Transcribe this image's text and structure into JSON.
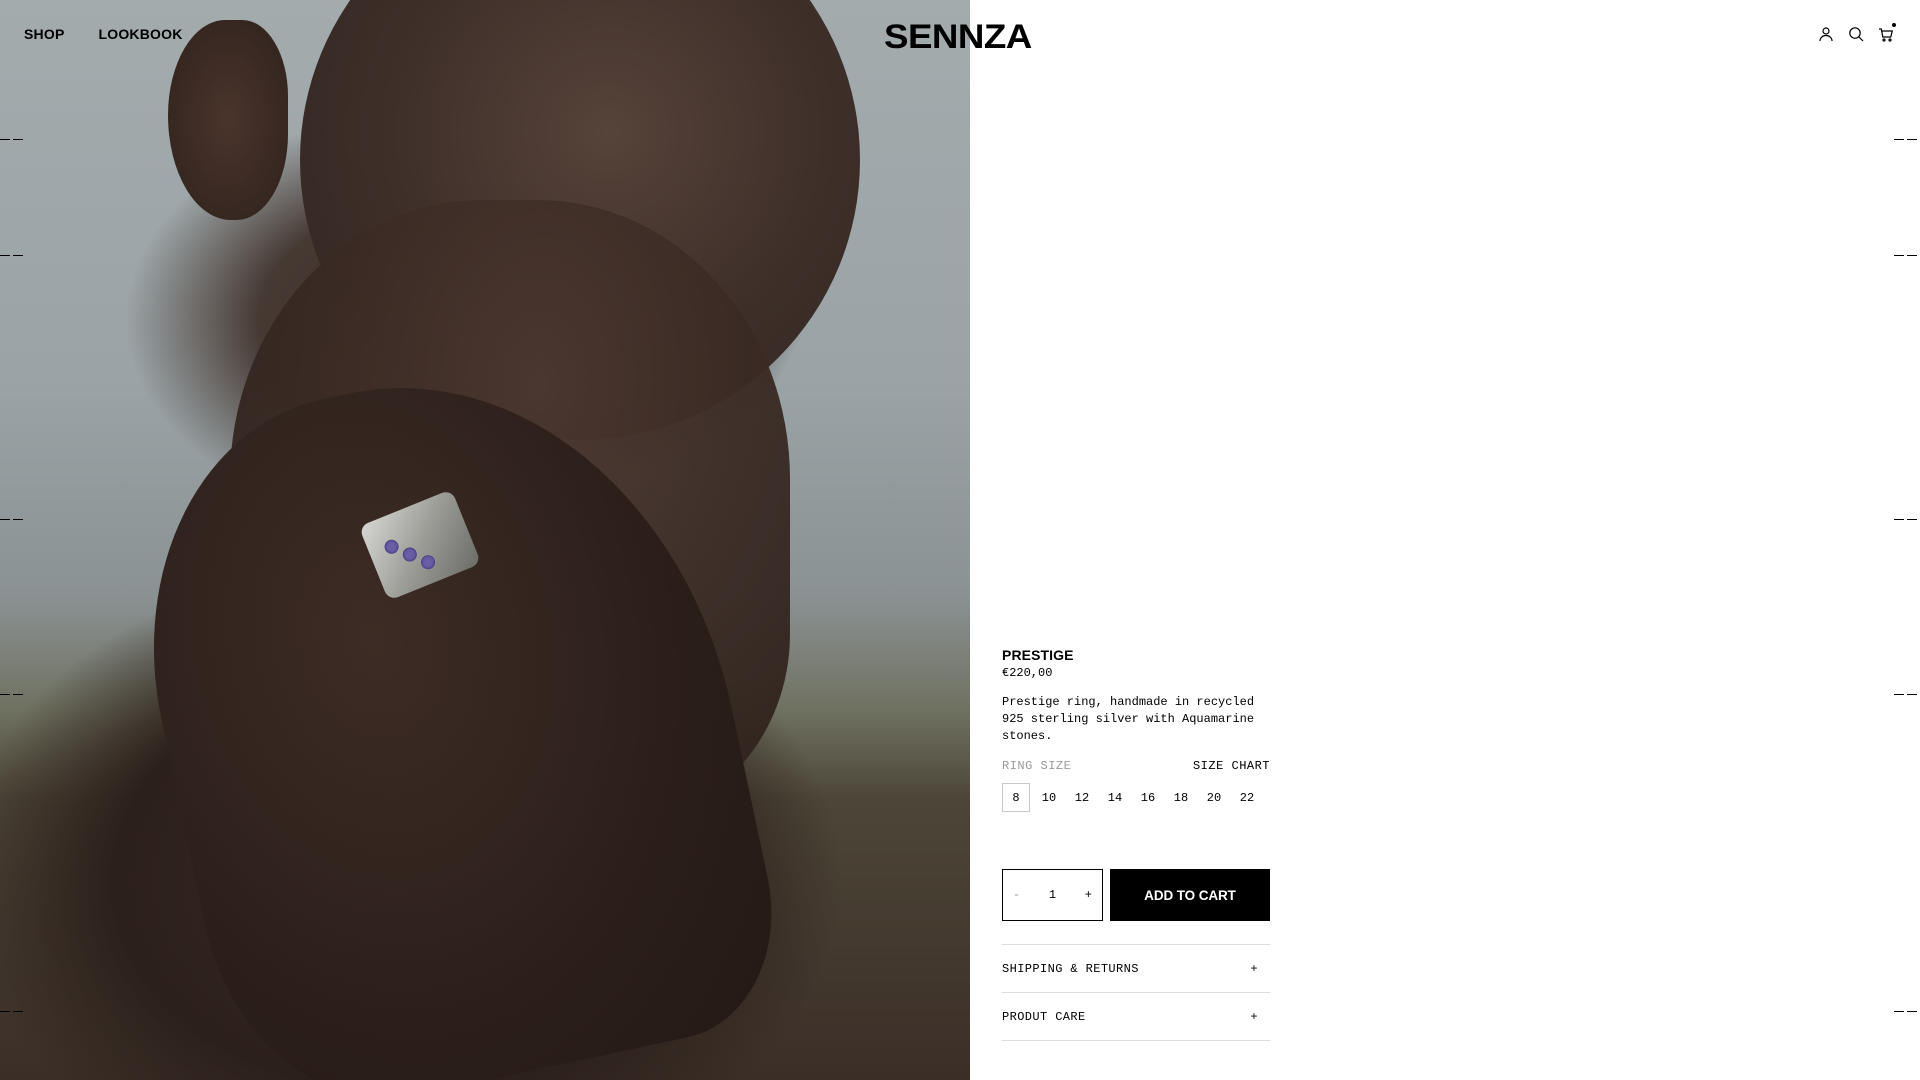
{
  "header": {
    "nav": [
      {
        "label": "SHOP"
      },
      {
        "label": "LOOKBOOK"
      }
    ],
    "logo": "SENNZA",
    "icons": [
      "account-icon",
      "search-icon",
      "cart-icon"
    ]
  },
  "product": {
    "title": "PRESTIGE",
    "price": "€220,00",
    "description": "Prestige ring, handmade in recycled 925 sterling silver with Aquamarine stones.",
    "size_label": "RING SIZE",
    "size_chart_label": "SIZE CHART",
    "sizes": [
      "8",
      "10",
      "12",
      "14",
      "16",
      "18",
      "20",
      "22"
    ],
    "selected_size": "8",
    "quantity": "1",
    "qty_minus": "-",
    "qty_plus": "+",
    "add_to_cart": "ADD TO CART",
    "accordions": [
      {
        "label": "SHIPPING & RETURNS",
        "toggle": "+"
      },
      {
        "label": "PRODUT CARE",
        "toggle": "+"
      }
    ]
  },
  "colors": {
    "text": "#000000",
    "muted": "#9a9a9a",
    "button_bg": "#000000",
    "button_text": "#ffffff",
    "divider": "#dedede"
  }
}
